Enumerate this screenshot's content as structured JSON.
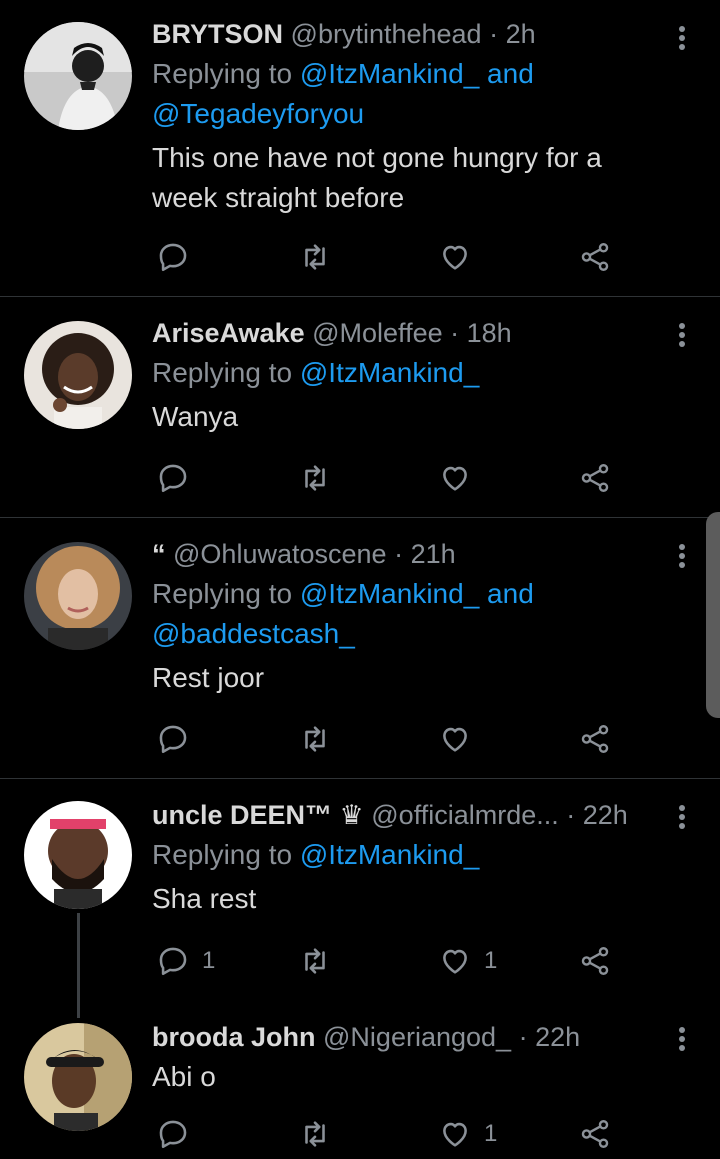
{
  "tweets": [
    {
      "name": "BRYTSON",
      "handle": "@brytinthehead",
      "time": "2h",
      "replying_prefix": "Replying to ",
      "reply_mentions_line1": "@ItzMankind_ and",
      "reply_mentions_line2": "@Tegadeyforyou",
      "text_line1": "This one have not gone hungry for a",
      "text_line2": "week straight before",
      "reply_count": "",
      "retweet_count": "",
      "like_count": ""
    },
    {
      "name": "AriseAwake",
      "handle": "@Moleffee",
      "time": "18h",
      "replying_prefix": "Replying to ",
      "reply_mentions_line1": "@ItzMankind_",
      "text_line1": "Wanya",
      "reply_count": "",
      "retweet_count": "",
      "like_count": ""
    },
    {
      "name": "“",
      "handle": "@Ohluwatoscene",
      "time": "21h",
      "replying_prefix": "Replying to ",
      "reply_mentions_line1": "@ItzMankind_ and",
      "reply_mentions_line2": "@baddestcash_",
      "text_line1": "Rest joor",
      "reply_count": "",
      "retweet_count": "",
      "like_count": ""
    },
    {
      "name": "uncle DEEN™ ♛",
      "handle": "@officialmrde...",
      "time": "22h",
      "replying_prefix": "Replying to ",
      "reply_mentions_line1": "@ItzMankind_",
      "text_line1": "Sha rest",
      "reply_count": "1",
      "retweet_count": "",
      "like_count": "1"
    },
    {
      "name": "brooda John",
      "handle": "@Nigeriangod_",
      "time": "22h",
      "text_line1": "Abi o",
      "reply_count": "",
      "retweet_count": "",
      "like_count": "1"
    }
  ],
  "icons": {
    "reply": "reply-icon",
    "retweet": "retweet-icon",
    "like": "heart-icon",
    "share": "share-icon",
    "more": "more-vertical-icon"
  },
  "colors": {
    "background": "#000000",
    "text": "#d9d9d9",
    "muted": "#8b9198",
    "mention": "#1d9bf0",
    "divider": "#2f3336"
  }
}
